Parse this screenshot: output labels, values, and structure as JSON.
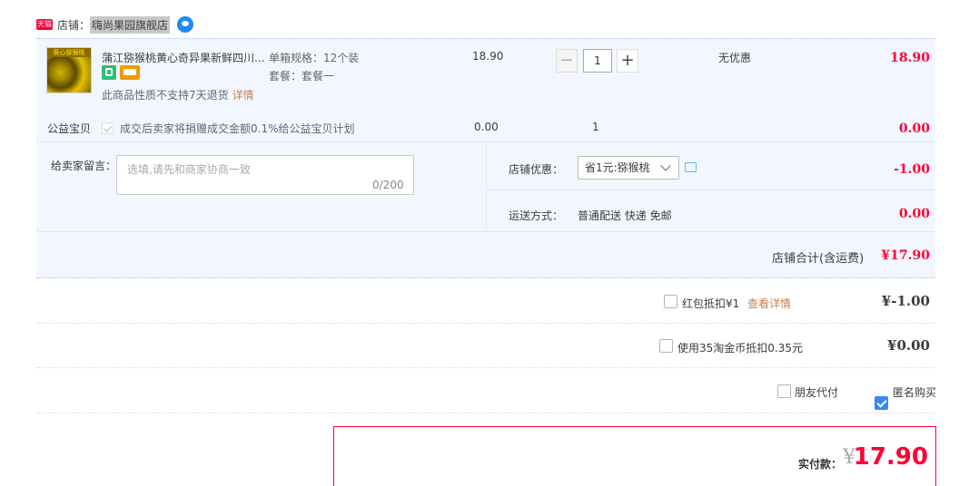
{
  "shop": {
    "badge": "天猫",
    "label": "店铺：",
    "name": "嗨尚果园旗舰店"
  },
  "item": {
    "title": "蒲江猕猴桃黄心奇异果新鲜四川...",
    "thumb_text": "黄心猕猴桃",
    "spec": "单箱规格：12个装",
    "package": "套餐：套餐一",
    "no_return": "此商品性质不支持7天退货",
    "detail_link": "详情",
    "unit_price": "18.90",
    "quantity": "1",
    "minus": "−",
    "plus": "+",
    "discount": "无优惠",
    "subtotal": "18.90"
  },
  "charity": {
    "label": "公益宝贝",
    "text": "成交后卖家将捐赠成交金额0.1%给公益宝贝计划",
    "price": "0.00",
    "quantity": "1",
    "subtotal": "0.00"
  },
  "memo": {
    "label": "给卖家留言：",
    "placeholder": "选填,请先和商家协商一致",
    "count": "0/200"
  },
  "shop_discount": {
    "label": "店铺优惠：",
    "selected": "省1元:猕猴桃",
    "amount": "-1.00"
  },
  "shipping": {
    "label": "运送方式：",
    "value": "普通配送 快递 免邮",
    "amount": "0.00"
  },
  "summary": {
    "label": "店铺合计(含运费)",
    "amount": "¥17.90"
  },
  "red_packet": {
    "label": "红包抵扣¥1",
    "link": "查看详情",
    "amount": "¥-1.00"
  },
  "taojinbi": {
    "label": "使用35淘金币抵扣0.35元",
    "amount": "¥0.00"
  },
  "friend_pay": {
    "label": "朋友代付",
    "checked": false
  },
  "anonymous": {
    "label": "匿名购买",
    "checked": true
  },
  "payment": {
    "label": "实付款：",
    "yen": "¥",
    "amount": "17.90"
  },
  "colors": {
    "accent_red": "#ff0036",
    "link_orange": "#c7814e",
    "checkbox_blue": "#3a86f6",
    "order_bg": "#f2f7ff"
  }
}
